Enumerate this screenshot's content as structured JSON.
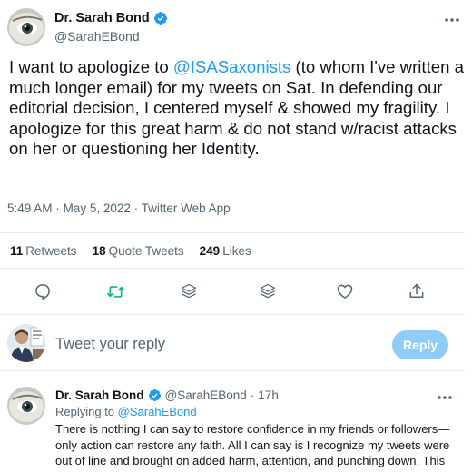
{
  "tweet": {
    "author_name": "Dr. Sarah Bond",
    "author_handle": "@SarahEBond",
    "text_before_mention": "I want to apologize to ",
    "mention": "@ISASaxonists",
    "text_after_mention": " (to whom I've written a much longer email) for my tweets on Sat. In defending our editorial decision, I centered myself & showed my fragility. I apologize for this great harm & do not stand w/racist attacks on her or questioning her Identity.",
    "time": "5:49 AM",
    "date": "May 5, 2022",
    "source": "Twitter Web App",
    "separator": "·"
  },
  "stats": {
    "retweets_count": "11",
    "retweets_label": "Retweets",
    "quotes_count": "18",
    "quotes_label": "Quote Tweets",
    "likes_count": "249",
    "likes_label": "Likes"
  },
  "actions": {
    "icons": [
      "reply-icon",
      "retweet-icon",
      "stack-icon",
      "stack-icon",
      "like-icon",
      "share-icon"
    ],
    "retweet_color": "#00ba7c",
    "default_color": "#536471"
  },
  "reply_compose": {
    "placeholder": "Tweet your reply",
    "button_label": "Reply",
    "button_color": "#8ecdf8"
  },
  "reply_tweet": {
    "author_name": "Dr. Sarah Bond",
    "author_handle": "@SarahEBond",
    "age": "17h",
    "replying_prefix": "Replying to ",
    "replying_handle": "@SarahEBond",
    "text": "There is nothing I can say to restore confidence in my friends or followers—only action can restore any faith. All I can say is I recognize my tweets were out of line and brought on added harm, attention, and punching down. This"
  },
  "colors": {
    "accent": "#1d9bf0",
    "text": "#0f1419",
    "muted": "#536471",
    "divider": "#e6ecf0"
  }
}
